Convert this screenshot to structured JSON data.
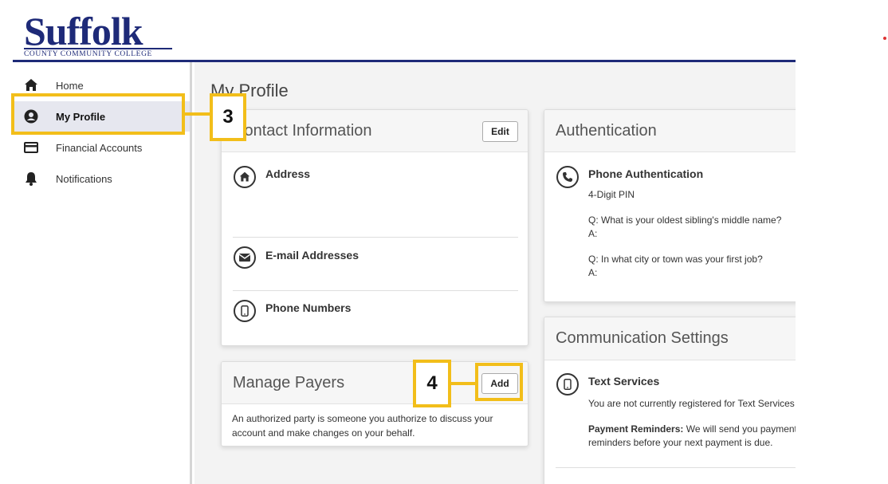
{
  "logo": {
    "name": "Suffolk",
    "subtitle": "COUNTY COMMUNITY COLLEGE"
  },
  "sidebar": {
    "items": [
      {
        "label": "Home",
        "icon": "home-icon"
      },
      {
        "label": "My Profile",
        "icon": "user-circle-icon",
        "active": true
      },
      {
        "label": "Financial Accounts",
        "icon": "credit-card-icon"
      },
      {
        "label": "Notifications",
        "icon": "bell-icon"
      }
    ]
  },
  "main": {
    "page_title": "My Profile",
    "contact": {
      "title": "Contact Information",
      "edit_label": "Edit",
      "address_label": "Address",
      "email_label": "E-mail Addresses",
      "phone_label": "Phone Numbers"
    },
    "payers": {
      "title": "Manage Payers",
      "add_label": "Add",
      "description_line1": "An authorized party is someone you authorize to discuss your",
      "description_line2": "account and make changes on your behalf."
    },
    "authentication": {
      "title": "Authentication",
      "phone_auth_label": "Phone Authentication",
      "pin_label": "4-Digit PIN",
      "q1": "Q: What is your oldest sibling's middle name?",
      "a1": "A:",
      "q2": "Q: In what city or town was your first job?",
      "a2": "A:"
    },
    "communication": {
      "title": "Communication Settings",
      "text_services_label": "Text Services",
      "not_registered": "You are not currently registered for Text Services",
      "reminders_bold": "Payment Reminders:",
      "reminders_text1": " We will send you payment",
      "reminders_text2": "reminders before your next payment is due."
    }
  },
  "callouts": {
    "step3": "3",
    "step4": "4"
  },
  "colors": {
    "brand": "#1e2a78",
    "callout": "#f2be1a",
    "active_nav": "#e6e7ef"
  }
}
